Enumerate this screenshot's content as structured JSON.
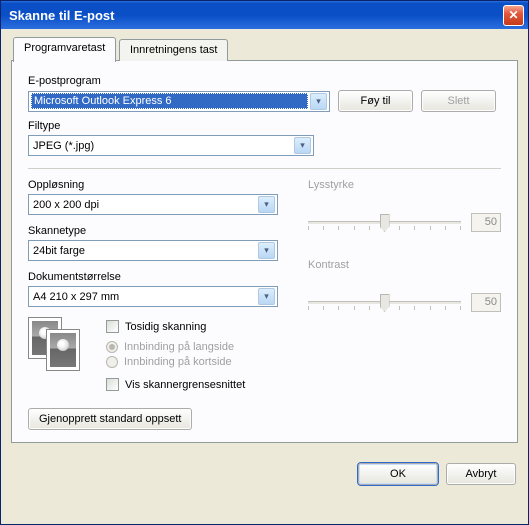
{
  "window": {
    "title": "Skanne til E-post"
  },
  "tabs": {
    "software": "Programvaretast",
    "device": "Innretningens tast"
  },
  "email": {
    "label": "E-postprogram",
    "selected": "Microsoft Outlook Express 6",
    "add_btn": "Føy til",
    "delete_btn": "Slett"
  },
  "filetype": {
    "label": "Filtype",
    "selected": "JPEG (*.jpg)"
  },
  "resolution": {
    "label": "Oppløsning",
    "selected": "200 x 200 dpi"
  },
  "scantype": {
    "label": "Skannetype",
    "selected": "24bit farge"
  },
  "docsize": {
    "label": "Dokumentstørrelse",
    "selected": "A4 210 x 297 mm"
  },
  "brightness": {
    "label": "Lysstyrke",
    "value": "50"
  },
  "contrast": {
    "label": "Kontrast",
    "value": "50"
  },
  "options": {
    "duplex": "Tosidig skanning",
    "long_edge": "Innbinding på langside",
    "short_edge": "Innbinding på kortside",
    "show_interface": "Vis skannergrensesnittet"
  },
  "restore_btn": "Gjenopprett standard oppsett",
  "ok_btn": "OK",
  "cancel_btn": "Avbryt"
}
